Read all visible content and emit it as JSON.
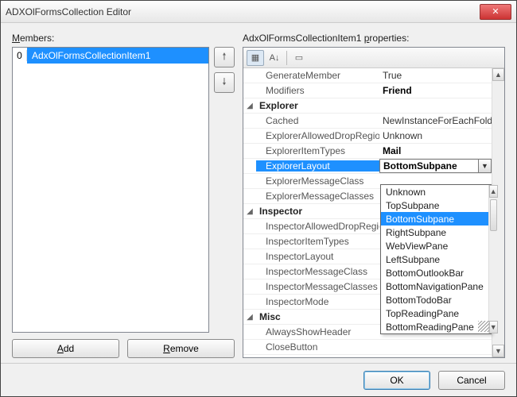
{
  "window": {
    "title": "ADXOlFormsCollection Editor"
  },
  "left": {
    "members_label": "Members:",
    "list": {
      "index": "0",
      "selected": "AdxOlFormsCollectionItem1"
    },
    "add_label": "Add",
    "remove_label": "Remove"
  },
  "right": {
    "props_label": "AdxOlFormsCollectionItem1 properties:",
    "rows": [
      {
        "kind": "prop",
        "name": "GenerateMember",
        "value": "True"
      },
      {
        "kind": "prop",
        "name": "Modifiers",
        "value": "Friend",
        "bold": true
      },
      {
        "kind": "cat",
        "name": "Explorer"
      },
      {
        "kind": "prop",
        "name": "Cached",
        "value": "NewInstanceForEachFolder"
      },
      {
        "kind": "prop",
        "name": "ExplorerAllowedDropRegions",
        "value": "Unknown"
      },
      {
        "kind": "prop",
        "name": "ExplorerItemTypes",
        "value": "Mail",
        "bold": true
      },
      {
        "kind": "sel",
        "name": "ExplorerLayout",
        "value": "BottomSubpane"
      },
      {
        "kind": "prop",
        "name": "ExplorerMessageClass",
        "value": ""
      },
      {
        "kind": "prop",
        "name": "ExplorerMessageClasses",
        "value": ""
      },
      {
        "kind": "cat",
        "name": "Inspector"
      },
      {
        "kind": "prop",
        "name": "InspectorAllowedDropRegions",
        "value": ""
      },
      {
        "kind": "prop",
        "name": "InspectorItemTypes",
        "value": ""
      },
      {
        "kind": "prop",
        "name": "InspectorLayout",
        "value": ""
      },
      {
        "kind": "prop",
        "name": "InspectorMessageClass",
        "value": ""
      },
      {
        "kind": "prop",
        "name": "InspectorMessageClasses",
        "value": ""
      },
      {
        "kind": "prop",
        "name": "InspectorMode",
        "value": ""
      },
      {
        "kind": "cat",
        "name": "Misc"
      },
      {
        "kind": "prop",
        "name": "AlwaysShowHeader",
        "value": ""
      },
      {
        "kind": "prop",
        "name": "CloseButton",
        "value": ""
      }
    ],
    "dropdown": {
      "selected": "BottomSubpane",
      "options": [
        "Unknown",
        "TopSubpane",
        "BottomSubpane",
        "RightSubpane",
        "WebViewPane",
        "LeftSubpane",
        "BottomOutlookBar",
        "BottomNavigationPane",
        "BottomTodoBar",
        "TopReadingPane",
        "BottomReadingPane"
      ]
    }
  },
  "footer": {
    "ok": "OK",
    "cancel": "Cancel"
  }
}
